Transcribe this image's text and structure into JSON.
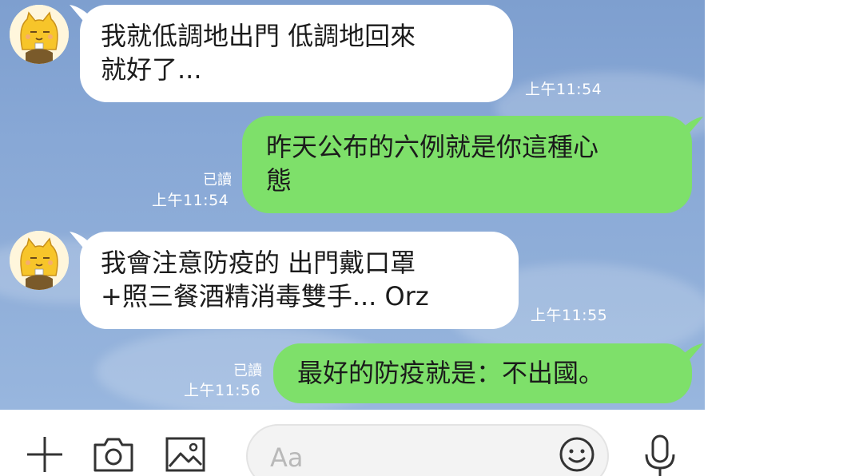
{
  "messages": [
    {
      "side": "in",
      "lines": [
        "我就低調地出門  低調地回來",
        "就好了..."
      ],
      "time": "上午11:54"
    },
    {
      "side": "out",
      "lines": [
        "昨天公布的六例就是你這種心",
        "態"
      ],
      "time": "上午11:54",
      "read": "已讀"
    },
    {
      "side": "in",
      "lines": [
        "我會注意防疫的  出門戴口罩",
        "+照三餐酒精消毒雙手... Orz"
      ],
      "time": "上午11:55"
    },
    {
      "side": "out",
      "lines": [
        "最好的防疫就是：不出國。"
      ],
      "time": "上午11:56",
      "read": "已讀"
    }
  ],
  "input": {
    "placeholder": "Aa"
  },
  "icons": {
    "add": "plus-icon",
    "camera": "camera-icon",
    "image": "image-icon",
    "emoji": "smiley-icon",
    "mic": "microphone-icon",
    "avatar": "yellow-cat-avatar"
  },
  "colors": {
    "chat_background": "#88a8d6",
    "incoming_bubble": "#ffffff",
    "outgoing_bubble": "#7ee06a",
    "timestamp": "#ffffff"
  }
}
